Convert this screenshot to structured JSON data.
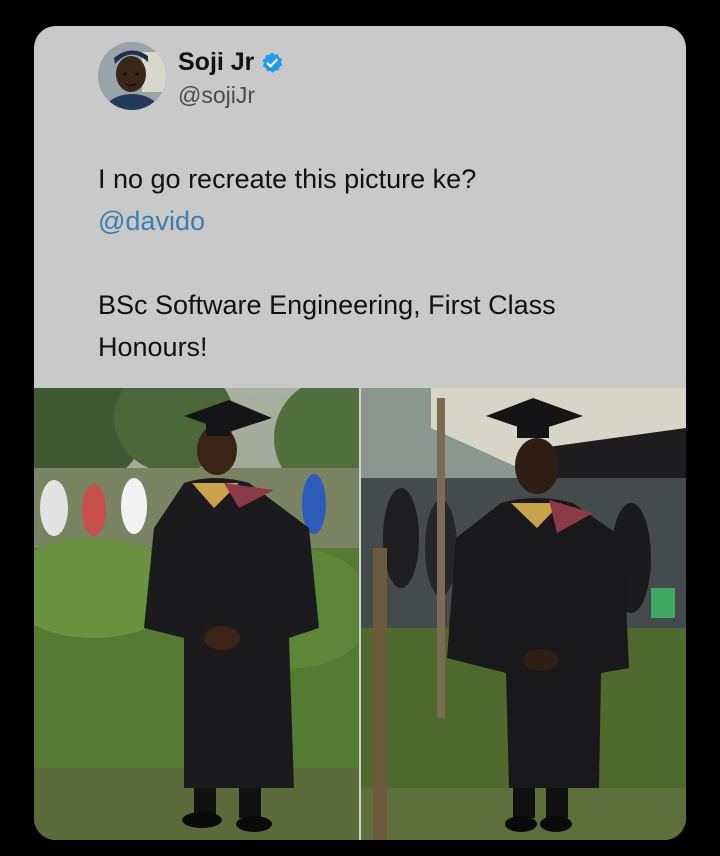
{
  "tweet": {
    "display_name": "Soji Jr",
    "handle": "@sojiJr",
    "verified_icon": "verified-badge-icon",
    "verified_color": "#1d9bf0",
    "text_line_1": "I no go recreate this picture ke?",
    "mention": "@davido",
    "text_line_3": "BSc Software Engineering, First Class",
    "text_line_4": "Honours!",
    "mention_color": "#3b7fb3"
  },
  "media": {
    "images": [
      {
        "name": "graduation-photo-left"
      },
      {
        "name": "graduation-photo-right"
      }
    ]
  }
}
